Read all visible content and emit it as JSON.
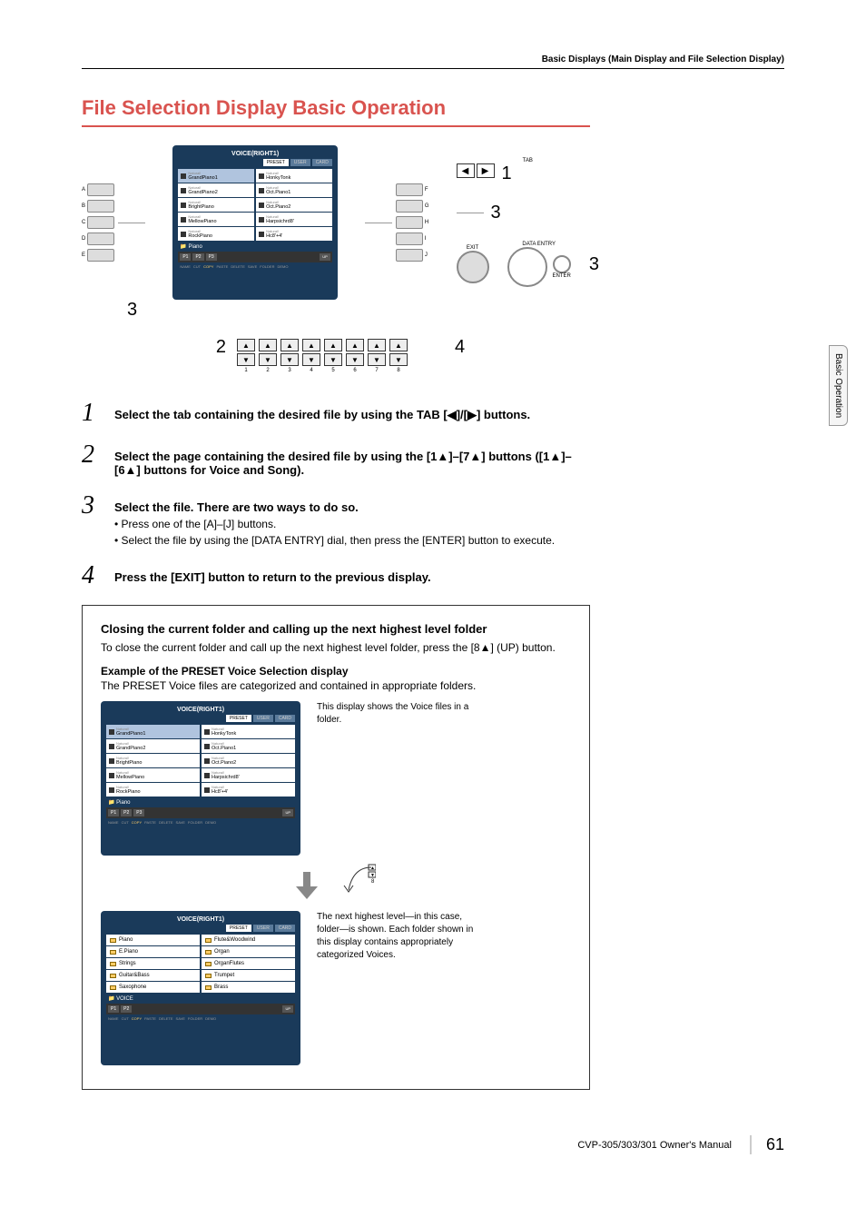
{
  "header": "Basic Displays (Main Display and File Selection Display)",
  "side_tab": "Basic Operation",
  "main_title": "File Selection Display Basic Operation",
  "diagram1": {
    "screen_title": "VOICE(RIGHT1)",
    "tabs": {
      "active": "PRESET",
      "inactive1": "USER",
      "inactive2": "CARD"
    },
    "voices_left": [
      {
        "nat": "Natural!",
        "name": "GrandPiano1"
      },
      {
        "nat": "Natural!",
        "name": "GrandPiano2"
      },
      {
        "nat": "Natural!",
        "name": "BrightPiano"
      },
      {
        "nat": "Natural!",
        "name": "MellowPiano"
      },
      {
        "nat": "Natural!",
        "name": "RockPiano"
      }
    ],
    "voices_right": [
      {
        "nat": "Natural!",
        "name": "HonkyTonk"
      },
      {
        "nat": "Natural!",
        "name": "Oct.Piano1"
      },
      {
        "nat": "Natural!",
        "name": "Oct.Piano2"
      },
      {
        "nat": "Natural!",
        "name": "Harpsichrd8'"
      },
      {
        "nat": "Natural!",
        "name": "Hc8'+4'"
      }
    ],
    "folder": "Piano",
    "pages": [
      "P1",
      "P2",
      "P3"
    ],
    "ops": [
      "NAME",
      "CUT",
      "COPY",
      "PASTE",
      "DELETE",
      "SAVE",
      "FOLDER",
      "DEMO"
    ],
    "up": "UP",
    "tab_label": "TAB",
    "exit_label": "EXIT",
    "data_entry_label": "DATA ENTRY",
    "enter_label": "ENTER",
    "callouts": {
      "c1": "1",
      "c2": "2",
      "c3": "3",
      "c4": "4"
    },
    "side_letters_left": [
      "A",
      "B",
      "C",
      "D",
      "E"
    ],
    "side_letters_right": [
      "F",
      "G",
      "H",
      "I",
      "J"
    ]
  },
  "steps": [
    {
      "num": "1",
      "main": "Select the tab containing the desired file by using the TAB [◀]/[▶] buttons."
    },
    {
      "num": "2",
      "main": "Select the page containing the desired file by using the [1▲]–[7▲] buttons ([1▲]–[6▲] buttons for Voice and Song)."
    },
    {
      "num": "3",
      "main": "Select the file. There are two ways to do so.",
      "sub": [
        "• Press one of the [A]–[J] buttons.",
        "• Select the file by using the [DATA ENTRY] dial, then press the [ENTER] button to execute."
      ]
    },
    {
      "num": "4",
      "main": "Press the [EXIT] button to return to the previous display."
    }
  ],
  "box": {
    "title": "Closing the current folder and calling up the next highest level folder",
    "text": "To close the current folder and call up the next highest level folder, press the [8▲] (UP) button.",
    "example_title": "Example of the PRESET Voice Selection display",
    "example_text": "The PRESET Voice files are categorized and contained in appropriate folders.",
    "caption1": "This display shows the Voice files in a folder.",
    "caption2": "The next highest level—in this case, folder—is shown. Each folder shown in this display contains appropriately categorized Voices.",
    "screen2": {
      "title": "VOICE(RIGHT1)",
      "tabs": {
        "active": "PRESET",
        "inactive1": "USER",
        "inactive2": "CARD"
      },
      "folders_left": [
        "Piano",
        "E.Piano",
        "Strings",
        "Guitar&Bass",
        "Saxophone"
      ],
      "folders_right": [
        "Flute&Woodwind",
        "Organ",
        "OrganFlutes",
        "Trumpet",
        "Brass"
      ],
      "folder": "VOICE",
      "pages": [
        "P1",
        "P2"
      ]
    }
  },
  "footer": {
    "manual": "CVP-305/303/301 Owner's Manual",
    "page": "61"
  }
}
